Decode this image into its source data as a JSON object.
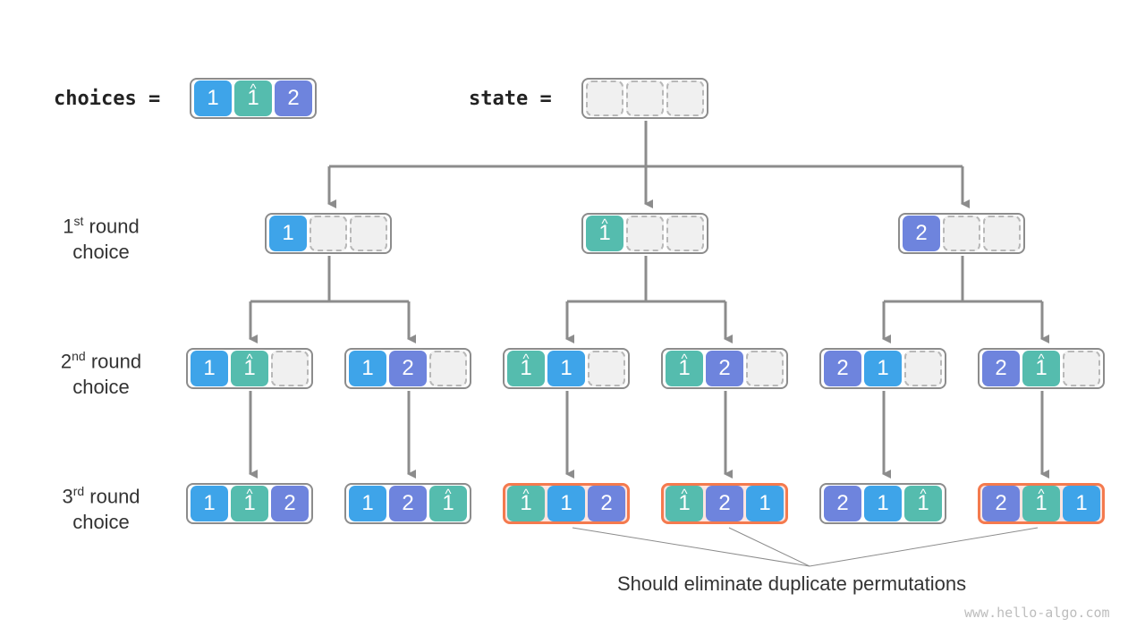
{
  "colors": {
    "1": "#3ea4e9",
    "1hat": "#55bcae",
    "2": "#6e84dd",
    "edge": "#8c8c8c",
    "dup_border": "#f47a4e",
    "dup_fill": "#fde4e0"
  },
  "header": {
    "choices_label": "choices =",
    "state_label": "state =",
    "choices": [
      "1",
      "1̂",
      "2"
    ],
    "state": [
      "",
      "",
      ""
    ]
  },
  "rows": [
    {
      "num": "1",
      "sup": "st",
      "rest": " round",
      "line2": "choice"
    },
    {
      "num": "2",
      "sup": "nd",
      "rest": " round",
      "line2": "choice"
    },
    {
      "num": "3",
      "sup": "rd",
      "rest": " round",
      "line2": "choice"
    }
  ],
  "level1": [
    [
      "1",
      "",
      ""
    ],
    [
      "1̂",
      "",
      ""
    ],
    [
      "2",
      "",
      ""
    ]
  ],
  "level2": [
    [
      "1",
      "1̂",
      ""
    ],
    [
      "1",
      "2",
      ""
    ],
    [
      "1̂",
      "1",
      ""
    ],
    [
      "1̂",
      "2",
      ""
    ],
    [
      "2",
      "1",
      ""
    ],
    [
      "2",
      "1̂",
      ""
    ]
  ],
  "level3": [
    {
      "cells": [
        "1",
        "1̂",
        "2"
      ],
      "duplicate": false
    },
    {
      "cells": [
        "1",
        "2",
        "1̂"
      ],
      "duplicate": false
    },
    {
      "cells": [
        "1̂",
        "1",
        "2"
      ],
      "duplicate": true
    },
    {
      "cells": [
        "1̂",
        "2",
        "1"
      ],
      "duplicate": true
    },
    {
      "cells": [
        "2",
        "1",
        "1̂"
      ],
      "duplicate": false
    },
    {
      "cells": [
        "2",
        "1̂",
        "1"
      ],
      "duplicate": true
    }
  ],
  "annotation": "Should eliminate duplicate permutations",
  "watermark": "www.hello-algo.com"
}
